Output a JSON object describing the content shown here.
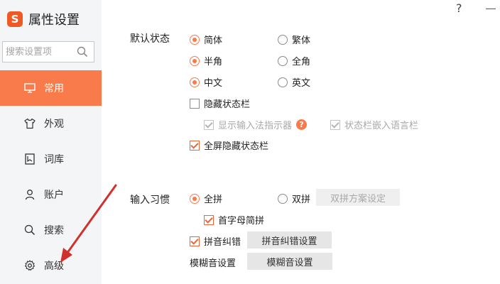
{
  "app": {
    "title": "属性设置",
    "logo_letter": "S"
  },
  "window": {
    "help": "?"
  },
  "search": {
    "placeholder": "搜索设置项"
  },
  "sidebar": {
    "items": [
      {
        "label": "常用",
        "icon": "monitor-icon",
        "active": true
      },
      {
        "label": "外观",
        "icon": "shirt-icon",
        "active": false
      },
      {
        "label": "词库",
        "icon": "book-icon",
        "active": false
      },
      {
        "label": "账户",
        "icon": "user-icon",
        "active": false
      },
      {
        "label": "搜索",
        "icon": "search-icon",
        "active": false
      },
      {
        "label": "高级",
        "icon": "gear-icon",
        "active": false
      }
    ]
  },
  "default_state": {
    "label": "默认状态",
    "simplified": "简体",
    "traditional": "繁体",
    "half_width": "半角",
    "full_width": "全角",
    "chinese": "中文",
    "english": "英文",
    "hide_status_bar": "隐藏状态栏",
    "show_ime_indicator": "显示输入法指示器",
    "embed_language_bar": "状态栏嵌入语言栏",
    "fullscreen_hide_status_bar": "全屏隐藏状态栏"
  },
  "input_habit": {
    "label": "输入习惯",
    "full_pinyin": "全拼",
    "double_pinyin": "双拼",
    "double_pinyin_settings": "双拼方案设定",
    "initials_short_pinyin": "首字母简拼",
    "pinyin_correction": "拼音纠错",
    "pinyin_correction_settings": "拼音纠错设置",
    "fuzzy_settings_label": "模糊音设置",
    "fuzzy_settings_button": "模糊音设置"
  },
  "colors": {
    "accent": "#f97a4a",
    "sidebar_bg": "#f4f5f7",
    "arrow": "#d0312d"
  }
}
